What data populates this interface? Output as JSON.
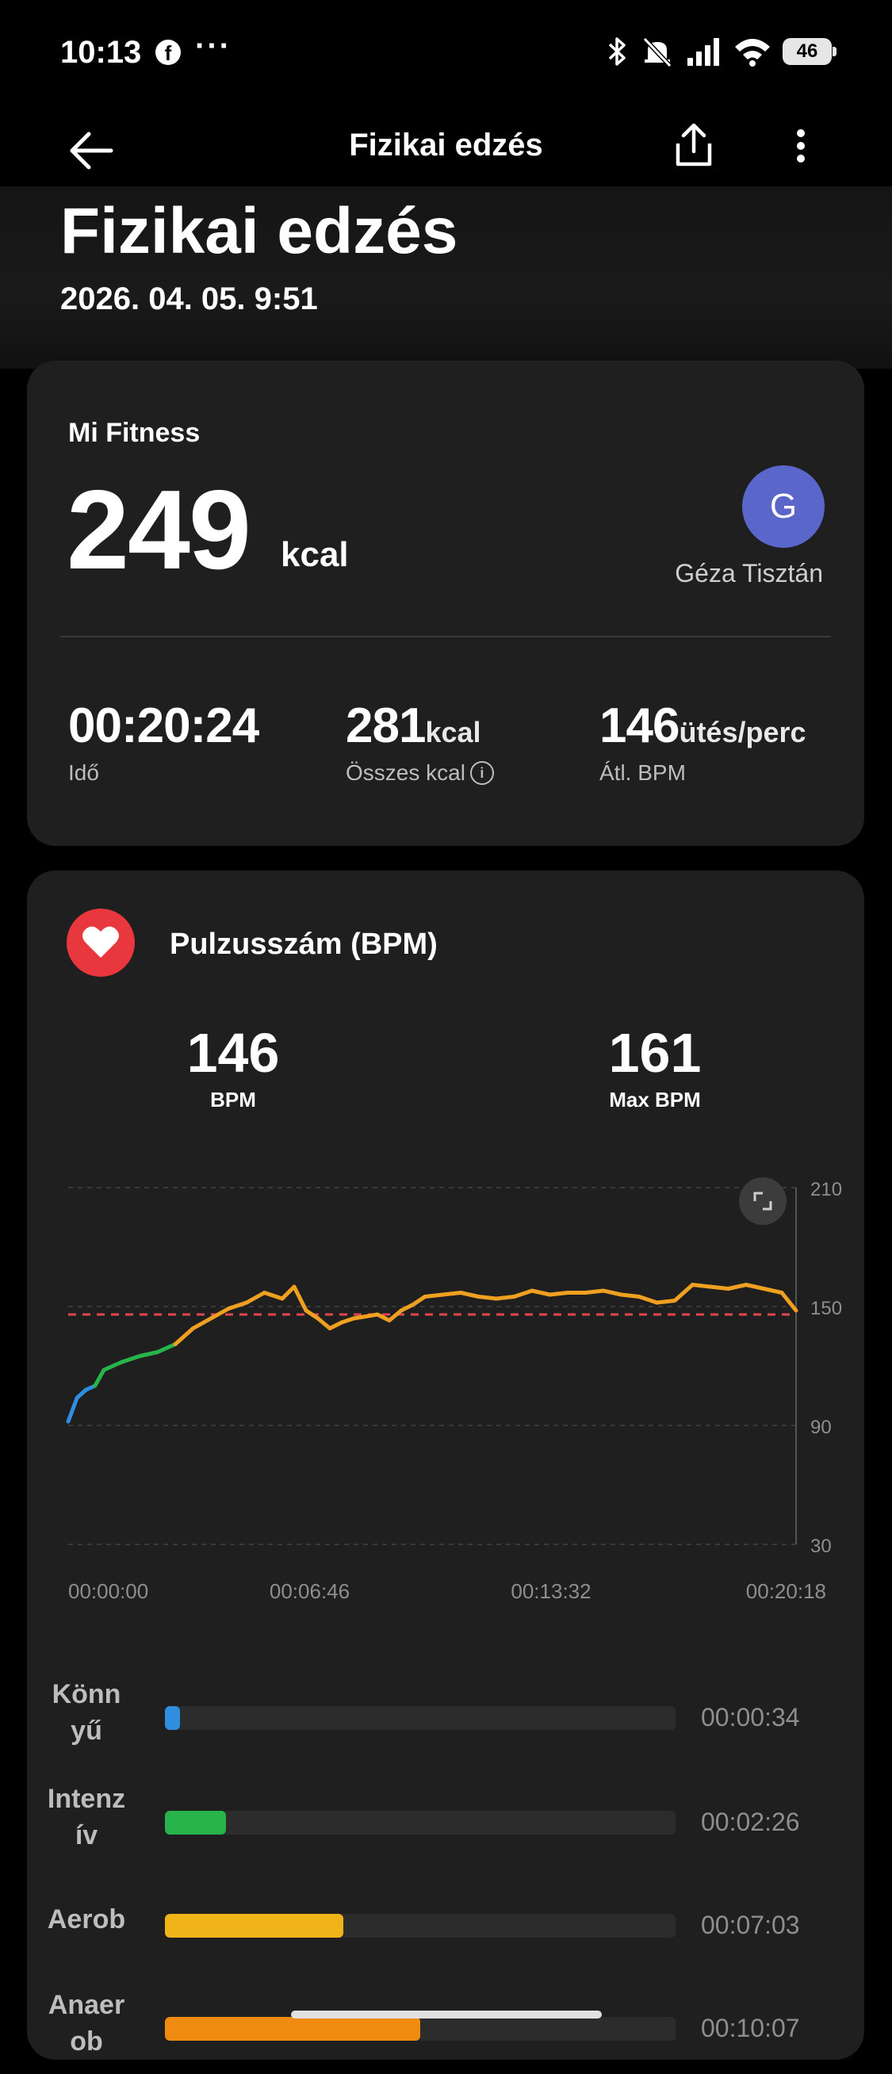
{
  "status_bar": {
    "time": "10:13",
    "battery": "46",
    "icons": [
      "facebook-icon",
      "more-dots-icon",
      "bluetooth-icon",
      "silent-icon",
      "signal-icon",
      "wifi-icon",
      "battery-icon"
    ]
  },
  "app_bar": {
    "title": "Fizikai edzés"
  },
  "header": {
    "title": "Fizikai edzés",
    "datetime": "2026. 04. 05. 9:51"
  },
  "summary": {
    "source": "Mi Fitness",
    "calories": "249",
    "calories_unit": "kcal",
    "avatar_letter": "G",
    "user_name": "Géza Tisztán",
    "avatar_color": "#5a66c9",
    "stats": [
      {
        "value": "00:20:24",
        "unit": "",
        "label": "Idő"
      },
      {
        "value": "281",
        "unit": "kcal",
        "label": "Összes kcal"
      },
      {
        "value": "146",
        "unit": "ütés/perc",
        "label": "Átl. BPM"
      }
    ]
  },
  "heart_rate": {
    "title": "Pulzusszám (BPM)",
    "avg_value": "146",
    "avg_label": "BPM",
    "max_value": "161",
    "max_label": "Max BPM"
  },
  "chart_data": {
    "type": "line",
    "ylim": [
      30,
      210
    ],
    "y_ticks": [
      "210",
      "150",
      "90",
      "30"
    ],
    "x_ticks": [
      "00:00:00",
      "00:06:46",
      "00:13:32",
      "00:20:18"
    ],
    "reference_line": 146,
    "series_colors": {
      "light": "#2f8ee0",
      "intensive": "#27b44b",
      "aerobic": "#f0a020"
    },
    "x_seconds": [
      0,
      15,
      30,
      45,
      60,
      90,
      120,
      150,
      180,
      210,
      240,
      270,
      300,
      330,
      360,
      380,
      400,
      420,
      440,
      460,
      480,
      500,
      520,
      540,
      560,
      580,
      600,
      630,
      660,
      690,
      720,
      750,
      780,
      810,
      840,
      870,
      900,
      930,
      960,
      990,
      1020,
      1050,
      1080,
      1110,
      1140,
      1170,
      1200,
      1224
    ],
    "bpm": [
      92,
      104,
      108,
      110,
      118,
      122,
      125,
      127,
      131,
      139,
      144,
      149,
      152,
      157,
      154,
      160,
      148,
      144,
      139,
      142,
      144,
      145,
      146,
      143,
      148,
      151,
      155,
      156,
      157,
      155,
      154,
      155,
      158,
      156,
      157,
      157,
      158,
      156,
      155,
      152,
      153,
      161,
      160,
      159,
      161,
      159,
      157,
      148
    ]
  },
  "zones": [
    {
      "label_line1": "Könn",
      "label_line2": "yű",
      "time": "00:00:34",
      "fraction": 0.03,
      "color": "#2f8ee0"
    },
    {
      "label_line1": "Intenz",
      "label_line2": "ív",
      "time": "00:02:26",
      "fraction": 0.12,
      "color": "#27b44b"
    },
    {
      "label_line1": "Aerob",
      "label_line2": "",
      "time": "00:07:03",
      "fraction": 0.35,
      "color": "#f0b418"
    },
    {
      "label_line1": "Anaer",
      "label_line2": "ob",
      "time": "00:10:07",
      "fraction": 0.5,
      "color": "#f08b12"
    }
  ]
}
